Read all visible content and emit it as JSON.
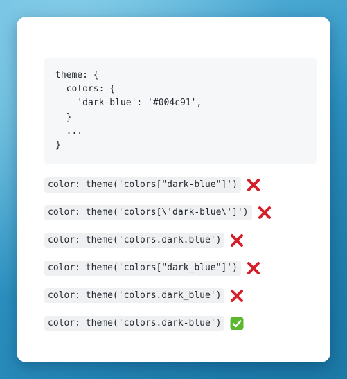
{
  "code_block": {
    "lines": [
      "theme: {",
      "  colors: {",
      "    'dark-blue': '#004c91',",
      "  }",
      "  ...",
      "}"
    ]
  },
  "examples": [
    {
      "code": "color: theme('colors[\"dark-blue\"]')",
      "result": "wrong",
      "icon": "red-cross-icon"
    },
    {
      "code": "color: theme('colors[\\'dark-blue\\']')",
      "result": "wrong",
      "icon": "red-cross-icon"
    },
    {
      "code": "color: theme('colors.dark.blue')",
      "result": "wrong",
      "icon": "red-cross-icon"
    },
    {
      "code": "color: theme('colors[\"dark_blue\"]')",
      "result": "wrong",
      "icon": "red-cross-icon"
    },
    {
      "code": "color: theme('colors.dark_blue')",
      "result": "wrong",
      "icon": "red-cross-icon"
    },
    {
      "code": "color: theme('colors.dark-blue')",
      "result": "correct",
      "icon": "green-check-icon"
    }
  ],
  "colors": {
    "cross": "#d4202a",
    "check_bg": "#5cb82e",
    "check_mark": "#ffffff"
  }
}
